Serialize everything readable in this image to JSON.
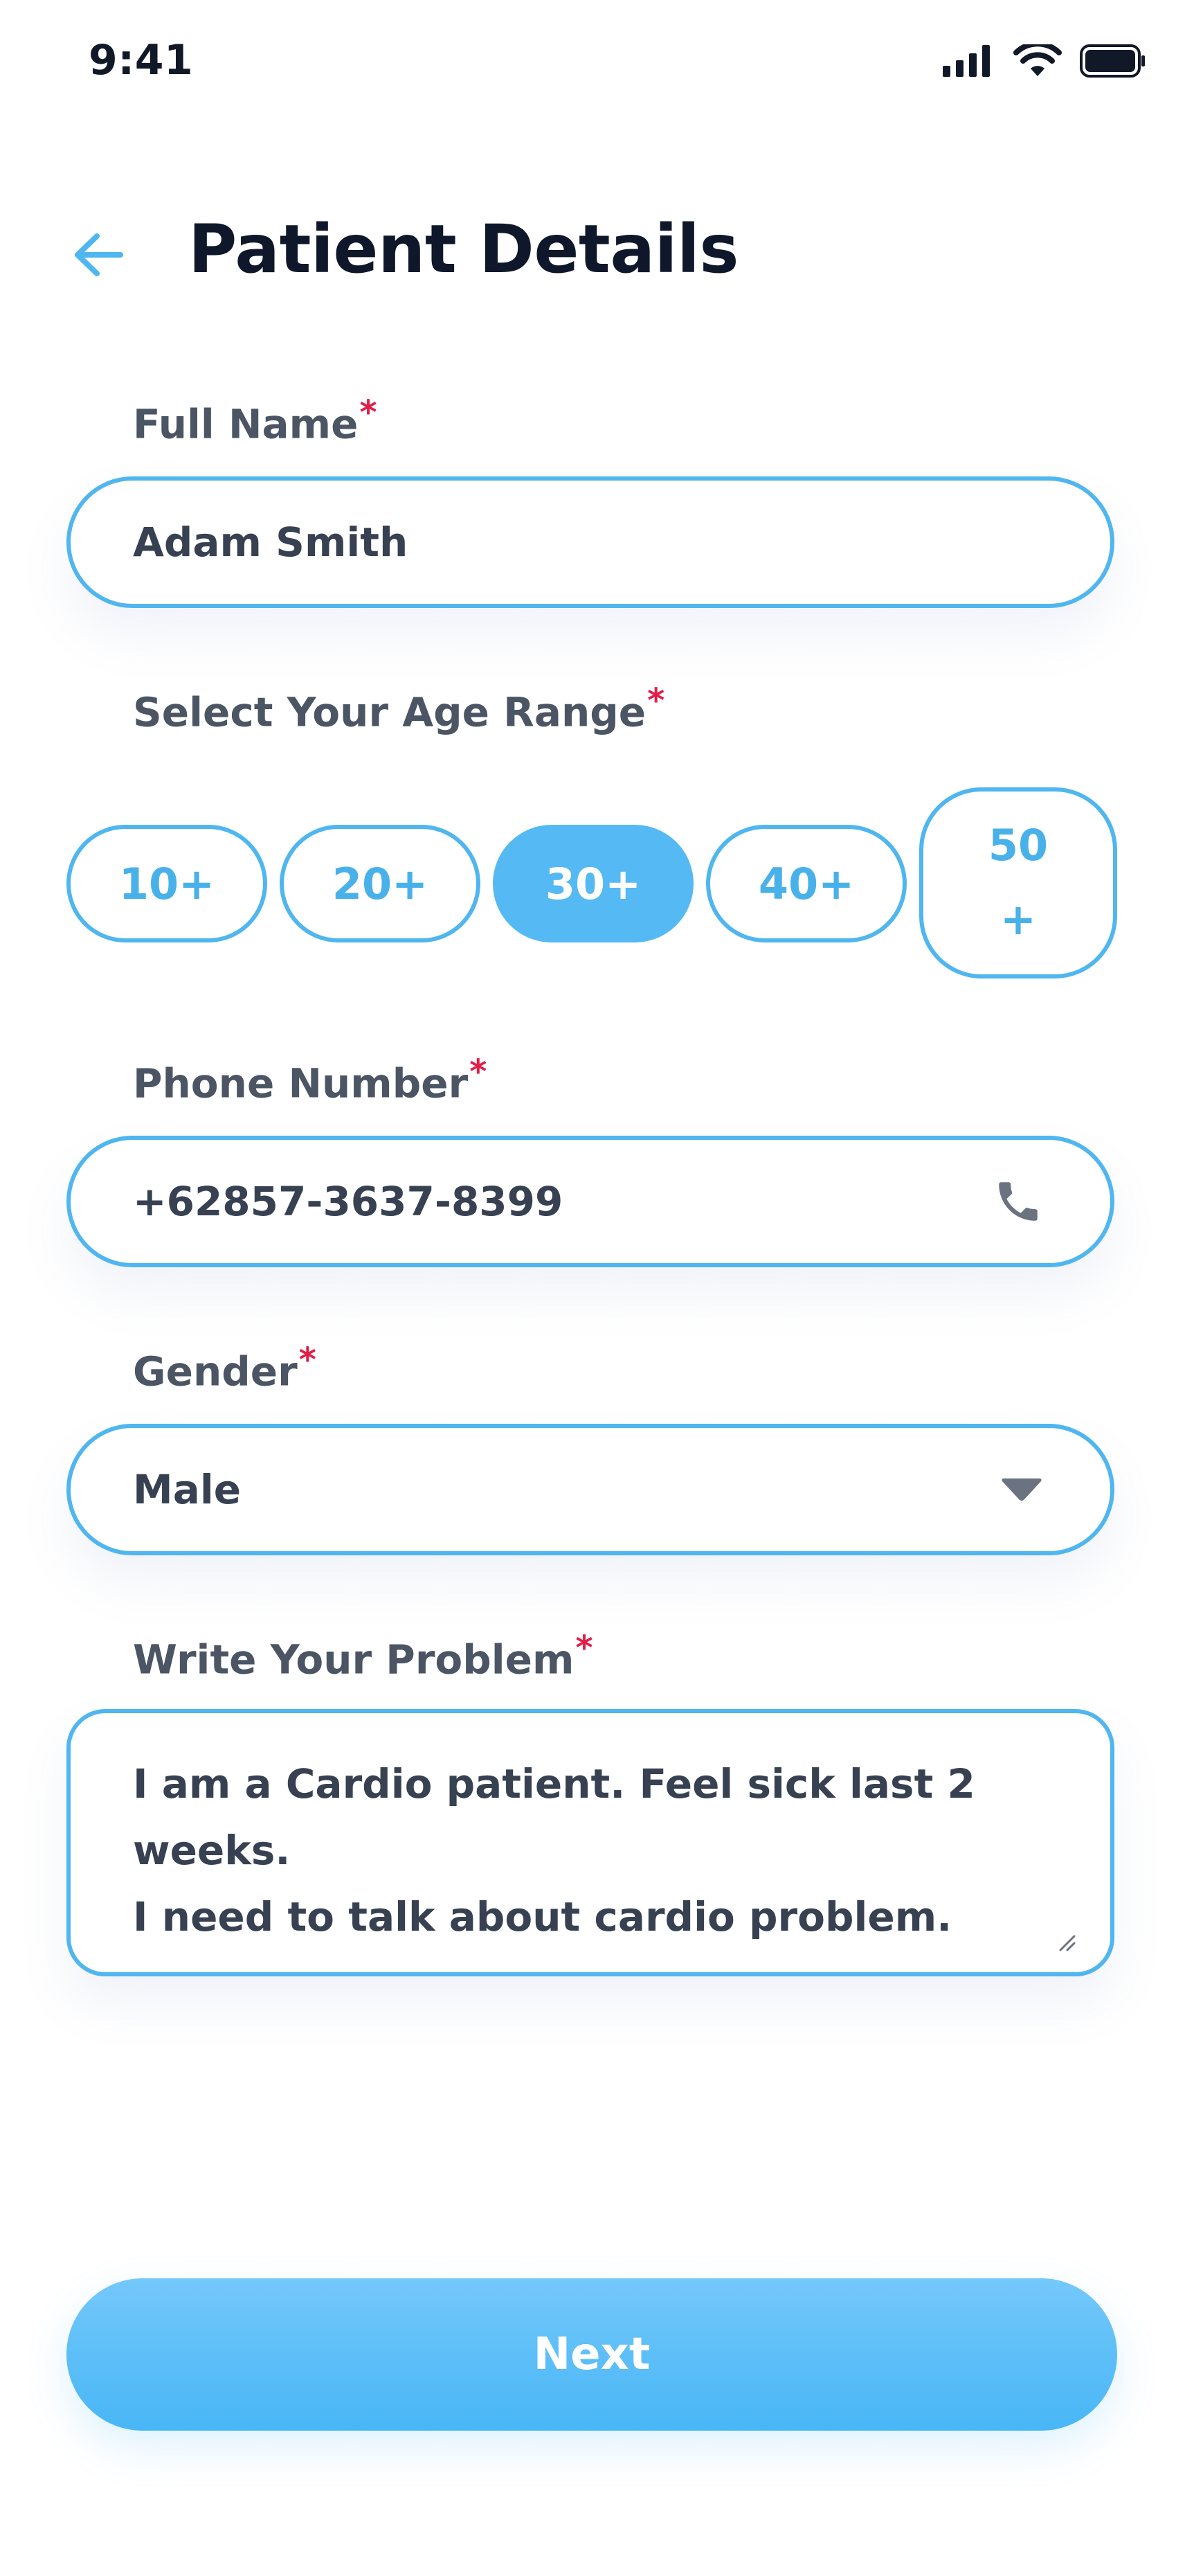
{
  "status_bar": {
    "time": "9:41"
  },
  "header": {
    "title": "Patient Details",
    "back_icon": "arrow-left-icon"
  },
  "form": {
    "full_name": {
      "label": "Full Name",
      "required_mark": "*",
      "value": "Adam Smith"
    },
    "age_range": {
      "label": "Select Your Age Range",
      "required_mark": "*",
      "options": [
        "10+",
        "20+",
        "30+",
        "40+",
        "50\n+"
      ],
      "selected": "30+"
    },
    "phone": {
      "label": "Phone Number",
      "required_mark": "*",
      "value": "+62857-3637-8399",
      "icon": "phone-icon"
    },
    "gender": {
      "label": "Gender",
      "required_mark": "*",
      "value": "Male",
      "icon": "caret-down-icon"
    },
    "problem": {
      "label": "Write Your Problem",
      "required_mark": "*",
      "value": "I am a Cardio patient. Feel sick last 2 weeks.\nI need to talk about cardio problem."
    }
  },
  "actions": {
    "next_label": "Next"
  },
  "colors": {
    "accent": "#4fb6ef",
    "accent_fill": "#55b9f3",
    "title": "#0f172a",
    "label": "#4b5563",
    "required": "#e11d48"
  }
}
